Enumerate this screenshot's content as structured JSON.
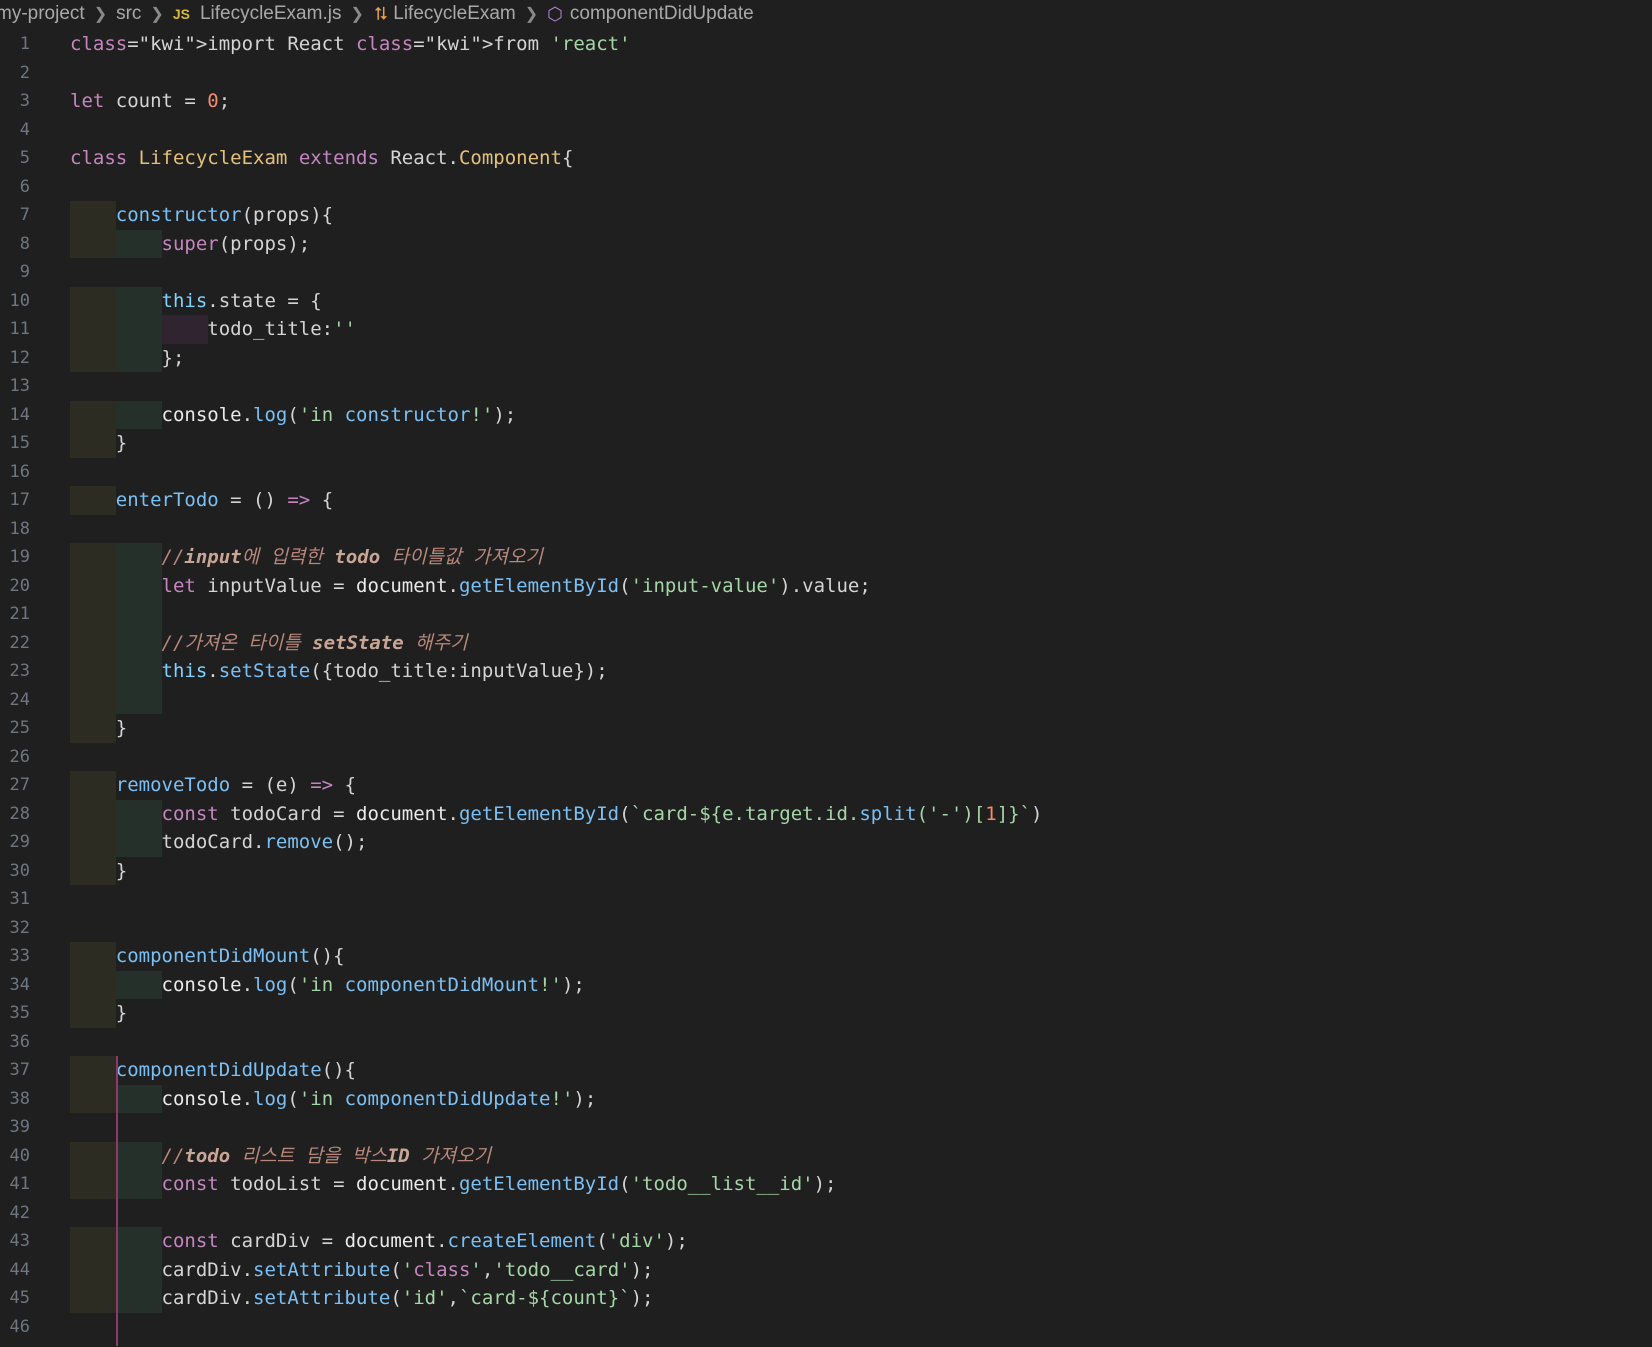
{
  "breadcrumb": {
    "project": "my-project",
    "folder": "src",
    "file_badge": "JS",
    "file": "LifecycleExam.js",
    "class": "LifecycleExam",
    "method": "componentDidUpdate"
  },
  "line_numbers": [
    "1",
    "2",
    "3",
    "4",
    "5",
    "6",
    "7",
    "8",
    "9",
    "10",
    "11",
    "12",
    "13",
    "14",
    "15",
    "16",
    "17",
    "18",
    "19",
    "20",
    "21",
    "22",
    "23",
    "24",
    "25",
    "26",
    "27",
    "28",
    "29",
    "30",
    "31",
    "32",
    "33",
    "34",
    "35",
    "36",
    "37",
    "38",
    "39",
    "40",
    "41",
    "42",
    "43",
    "44",
    "45",
    "46"
  ],
  "code_lines": [
    "import React from 'react'",
    "",
    "let count = 0;",
    "",
    "class LifecycleExam extends React.Component{",
    "",
    "    constructor(props){",
    "        super(props);",
    "",
    "        this.state = {",
    "            todo_title:''",
    "        };",
    "",
    "        console.log('in constructor!');",
    "    }",
    "",
    "    enterTodo = () => {",
    "",
    "        //input에 입력한 todo 타이틀값 가져오기",
    "        let inputValue = document.getElementById('input-value').value;",
    "",
    "        //가져온 타이틀 setState 해주기",
    "        this.setState({todo_title:inputValue});",
    "",
    "    }",
    "",
    "    removeTodo = (e) => {",
    "        const todoCard = document.getElementById(`card-${e.target.id.split('-')[1]}`)",
    "        todoCard.remove();",
    "    }",
    "",
    "",
    "    componentDidMount(){",
    "        console.log('in componentDidMount!');",
    "    }",
    "",
    "    componentDidUpdate(){",
    "        console.log('in componentDidUpdate!');",
    "",
    "        //todo 리스트 담을 박스ID 가져오기",
    "        const todoList = document.getElementById('todo__list__id');",
    "",
    "        const cardDiv = document.createElement('div');",
    "        cardDiv.setAttribute('class','todo__card');",
    "        cardDiv.setAttribute('id',`card-${count}`);",
    ""
  ]
}
